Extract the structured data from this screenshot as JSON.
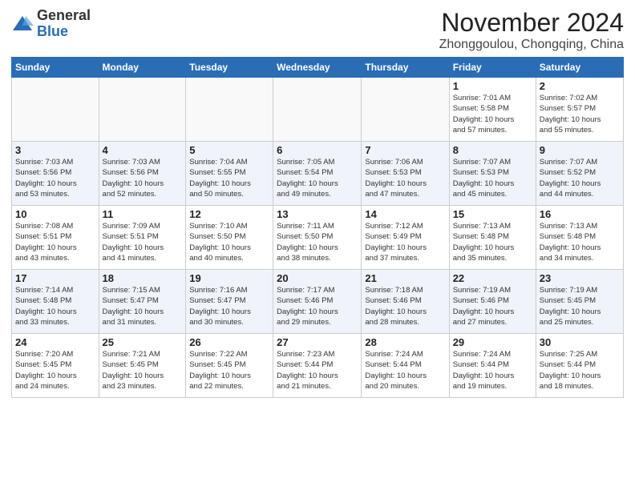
{
  "header": {
    "logo_general": "General",
    "logo_blue": "Blue",
    "month_title": "November 2024",
    "location": "Zhonggoulou, Chongqing, China"
  },
  "weekdays": [
    "Sunday",
    "Monday",
    "Tuesday",
    "Wednesday",
    "Thursday",
    "Friday",
    "Saturday"
  ],
  "weeks": [
    [
      {
        "day": "",
        "info": ""
      },
      {
        "day": "",
        "info": ""
      },
      {
        "day": "",
        "info": ""
      },
      {
        "day": "",
        "info": ""
      },
      {
        "day": "",
        "info": ""
      },
      {
        "day": "1",
        "info": "Sunrise: 7:01 AM\nSunset: 5:58 PM\nDaylight: 10 hours\nand 57 minutes."
      },
      {
        "day": "2",
        "info": "Sunrise: 7:02 AM\nSunset: 5:57 PM\nDaylight: 10 hours\nand 55 minutes."
      }
    ],
    [
      {
        "day": "3",
        "info": "Sunrise: 7:03 AM\nSunset: 5:56 PM\nDaylight: 10 hours\nand 53 minutes."
      },
      {
        "day": "4",
        "info": "Sunrise: 7:03 AM\nSunset: 5:56 PM\nDaylight: 10 hours\nand 52 minutes."
      },
      {
        "day": "5",
        "info": "Sunrise: 7:04 AM\nSunset: 5:55 PM\nDaylight: 10 hours\nand 50 minutes."
      },
      {
        "day": "6",
        "info": "Sunrise: 7:05 AM\nSunset: 5:54 PM\nDaylight: 10 hours\nand 49 minutes."
      },
      {
        "day": "7",
        "info": "Sunrise: 7:06 AM\nSunset: 5:53 PM\nDaylight: 10 hours\nand 47 minutes."
      },
      {
        "day": "8",
        "info": "Sunrise: 7:07 AM\nSunset: 5:53 PM\nDaylight: 10 hours\nand 45 minutes."
      },
      {
        "day": "9",
        "info": "Sunrise: 7:07 AM\nSunset: 5:52 PM\nDaylight: 10 hours\nand 44 minutes."
      }
    ],
    [
      {
        "day": "10",
        "info": "Sunrise: 7:08 AM\nSunset: 5:51 PM\nDaylight: 10 hours\nand 43 minutes."
      },
      {
        "day": "11",
        "info": "Sunrise: 7:09 AM\nSunset: 5:51 PM\nDaylight: 10 hours\nand 41 minutes."
      },
      {
        "day": "12",
        "info": "Sunrise: 7:10 AM\nSunset: 5:50 PM\nDaylight: 10 hours\nand 40 minutes."
      },
      {
        "day": "13",
        "info": "Sunrise: 7:11 AM\nSunset: 5:50 PM\nDaylight: 10 hours\nand 38 minutes."
      },
      {
        "day": "14",
        "info": "Sunrise: 7:12 AM\nSunset: 5:49 PM\nDaylight: 10 hours\nand 37 minutes."
      },
      {
        "day": "15",
        "info": "Sunrise: 7:13 AM\nSunset: 5:48 PM\nDaylight: 10 hours\nand 35 minutes."
      },
      {
        "day": "16",
        "info": "Sunrise: 7:13 AM\nSunset: 5:48 PM\nDaylight: 10 hours\nand 34 minutes."
      }
    ],
    [
      {
        "day": "17",
        "info": "Sunrise: 7:14 AM\nSunset: 5:48 PM\nDaylight: 10 hours\nand 33 minutes."
      },
      {
        "day": "18",
        "info": "Sunrise: 7:15 AM\nSunset: 5:47 PM\nDaylight: 10 hours\nand 31 minutes."
      },
      {
        "day": "19",
        "info": "Sunrise: 7:16 AM\nSunset: 5:47 PM\nDaylight: 10 hours\nand 30 minutes."
      },
      {
        "day": "20",
        "info": "Sunrise: 7:17 AM\nSunset: 5:46 PM\nDaylight: 10 hours\nand 29 minutes."
      },
      {
        "day": "21",
        "info": "Sunrise: 7:18 AM\nSunset: 5:46 PM\nDaylight: 10 hours\nand 28 minutes."
      },
      {
        "day": "22",
        "info": "Sunrise: 7:19 AM\nSunset: 5:46 PM\nDaylight: 10 hours\nand 27 minutes."
      },
      {
        "day": "23",
        "info": "Sunrise: 7:19 AM\nSunset: 5:45 PM\nDaylight: 10 hours\nand 25 minutes."
      }
    ],
    [
      {
        "day": "24",
        "info": "Sunrise: 7:20 AM\nSunset: 5:45 PM\nDaylight: 10 hours\nand 24 minutes."
      },
      {
        "day": "25",
        "info": "Sunrise: 7:21 AM\nSunset: 5:45 PM\nDaylight: 10 hours\nand 23 minutes."
      },
      {
        "day": "26",
        "info": "Sunrise: 7:22 AM\nSunset: 5:45 PM\nDaylight: 10 hours\nand 22 minutes."
      },
      {
        "day": "27",
        "info": "Sunrise: 7:23 AM\nSunset: 5:44 PM\nDaylight: 10 hours\nand 21 minutes."
      },
      {
        "day": "28",
        "info": "Sunrise: 7:24 AM\nSunset: 5:44 PM\nDaylight: 10 hours\nand 20 minutes."
      },
      {
        "day": "29",
        "info": "Sunrise: 7:24 AM\nSunset: 5:44 PM\nDaylight: 10 hours\nand 19 minutes."
      },
      {
        "day": "30",
        "info": "Sunrise: 7:25 AM\nSunset: 5:44 PM\nDaylight: 10 hours\nand 18 minutes."
      }
    ]
  ]
}
